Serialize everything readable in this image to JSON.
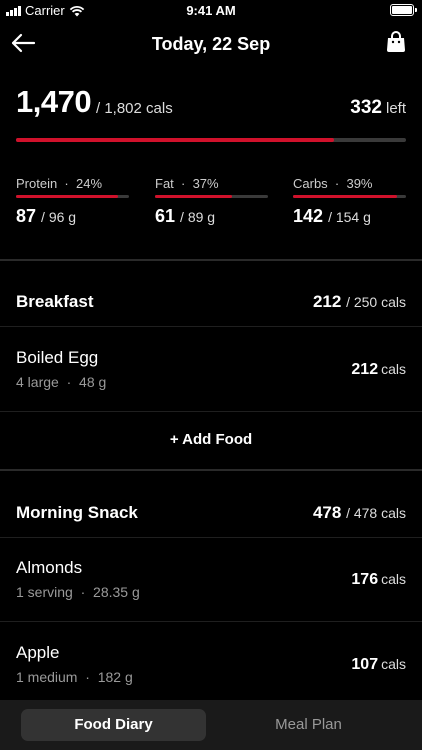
{
  "status_bar": {
    "carrier": "Carrier",
    "time": "9:41 AM"
  },
  "header": {
    "title": "Today, 22 Sep",
    "back_icon": "arrow-left-icon",
    "bag_icon": "shopping-bag-icon"
  },
  "summary": {
    "eaten": "1,470",
    "goal": "/ 1,802 cals",
    "remaining": "332",
    "remaining_label": "left",
    "progress": 0.816
  },
  "macros": [
    {
      "name": "Protein",
      "percent": "24%",
      "value": "87",
      "goal": "/ 96 g",
      "progress": 0.906
    },
    {
      "name": "Fat",
      "percent": "37%",
      "value": "61",
      "goal": "/ 89 g",
      "progress": 0.685
    },
    {
      "name": "Carbs",
      "percent": "39%",
      "value": "142",
      "goal": "/ 154 g",
      "progress": 0.922
    }
  ],
  "meals": [
    {
      "name": "Breakfast",
      "cals": "212",
      "goal": "/ 250 cals",
      "foods": [
        {
          "name": "Boiled Egg",
          "qty": "4 large",
          "weight": "48 g",
          "cals": "212",
          "unit": "cals"
        }
      ],
      "add_label": "+ Add Food"
    },
    {
      "name": "Morning Snack",
      "cals": "478",
      "goal": "/ 478 cals",
      "foods": [
        {
          "name": "Almonds",
          "qty": "1 serving",
          "weight": "28.35 g",
          "cals": "176",
          "unit": "cals"
        },
        {
          "name": "Apple",
          "qty": "1 medium",
          "weight": "182 g",
          "cals": "107",
          "unit": "cals"
        }
      ]
    }
  ],
  "tabs": [
    {
      "label": "Food Diary",
      "active": true
    },
    {
      "label": "Meal Plan",
      "active": false
    }
  ],
  "colors": {
    "accent": "#d0112b",
    "background": "#000000",
    "tab_bar": "#1a1a1a"
  }
}
